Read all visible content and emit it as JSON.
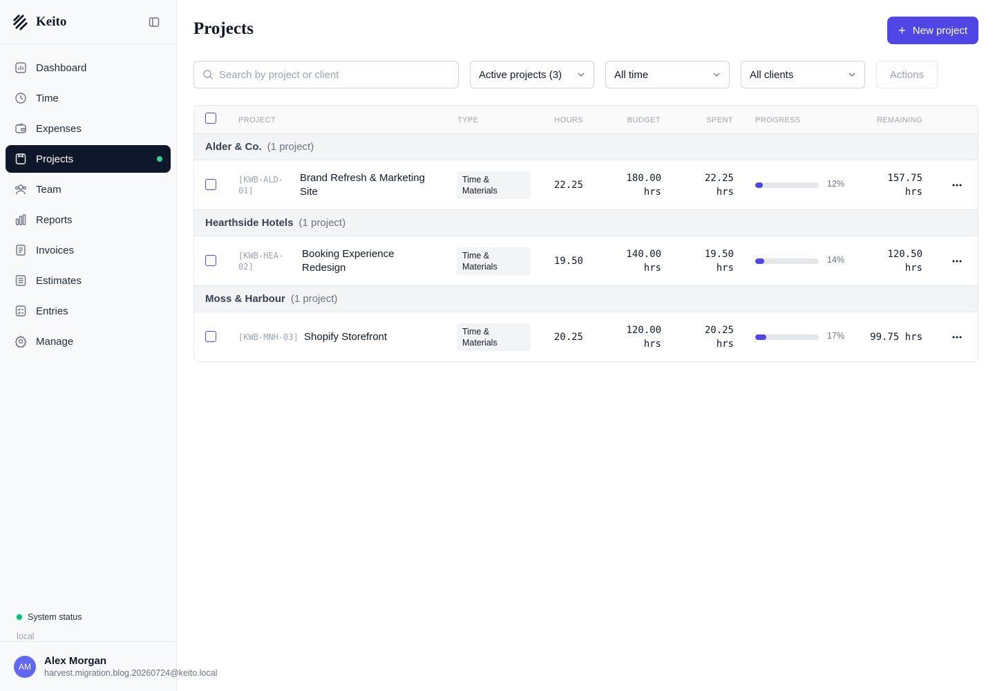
{
  "brand": {
    "name": "Keito"
  },
  "sidebar": {
    "items": [
      {
        "label": "Dashboard",
        "icon": "dashboard-icon"
      },
      {
        "label": "Time",
        "icon": "clock-icon"
      },
      {
        "label": "Expenses",
        "icon": "wallet-icon"
      },
      {
        "label": "Projects",
        "icon": "folder-icon",
        "active": true
      },
      {
        "label": "Team",
        "icon": "team-icon"
      },
      {
        "label": "Reports",
        "icon": "bar-chart-icon"
      },
      {
        "label": "Invoices",
        "icon": "invoice-icon"
      },
      {
        "label": "Estimates",
        "icon": "list-icon"
      },
      {
        "label": "Entries",
        "icon": "checklist-icon"
      },
      {
        "label": "Manage",
        "icon": "gear-icon"
      }
    ],
    "status": {
      "label": "System status",
      "env": "local",
      "color": "#10b981"
    }
  },
  "user": {
    "initials": "AM",
    "name": "Alex Morgan",
    "email": "harvest.migration.blog.20260724@keito.local"
  },
  "page": {
    "title": "Projects",
    "new_button": "New project",
    "search_placeholder": "Search by project or client",
    "filters": {
      "status": "Active projects (3)",
      "period": "All time",
      "client": "All clients"
    },
    "actions_label": "Actions"
  },
  "table": {
    "headers": {
      "project": "PROJECT",
      "type": "TYPE",
      "hours": "HOURS",
      "budget": "BUDGET",
      "spent": "SPENT",
      "progress": "PROGRESS",
      "remaining": "REMAINING"
    },
    "groups": [
      {
        "client": "Alder & Co.",
        "count": "(1 project)",
        "row": {
          "code_l1": "[KWB-ALD-",
          "code_l2": "01]",
          "name_l1": "Brand Refresh & Marketing",
          "name_l2": "Site",
          "type_l1": "Time &",
          "type_l2": "Materials",
          "hours": "22.25",
          "budget_l1": "180.00",
          "budget_l2": "hrs",
          "spent_l1": "22.25",
          "spent_l2": "hrs",
          "progress": 12,
          "progress_label": "12%",
          "remaining_l1": "157.75",
          "remaining_l2": "hrs"
        }
      },
      {
        "client": "Hearthside Hotels",
        "count": "(1 project)",
        "row": {
          "code_l1": "[KWB-HEA-",
          "code_l2": "02]",
          "name_l1": "Booking Experience",
          "name_l2": "Redesign",
          "type_l1": "Time &",
          "type_l2": "Materials",
          "hours": "19.50",
          "budget_l1": "140.00",
          "budget_l2": "hrs",
          "spent_l1": "19.50",
          "spent_l2": "hrs",
          "progress": 14,
          "progress_label": "14%",
          "remaining_l1": "120.50",
          "remaining_l2": "hrs"
        }
      },
      {
        "client": "Moss & Harbour",
        "count": "(1 project)",
        "row": {
          "code_l1": "[KWB-MNH-03]",
          "code_l2": "",
          "name_l1": "Shopify Storefront",
          "name_l2": "",
          "type_l1": "Time &",
          "type_l2": "Materials",
          "hours": "20.25",
          "budget_l1": "120.00",
          "budget_l2": "hrs",
          "spent_l1": "20.25",
          "spent_l2": "hrs",
          "progress": 17,
          "progress_label": "17%",
          "remaining_l1": "99.75 hrs",
          "remaining_l2": ""
        }
      }
    ]
  },
  "colors": {
    "accent": "#4f46e5",
    "active_nav": "#0f172a",
    "active_dot": "#34d399",
    "avatar": "#6366f1"
  }
}
